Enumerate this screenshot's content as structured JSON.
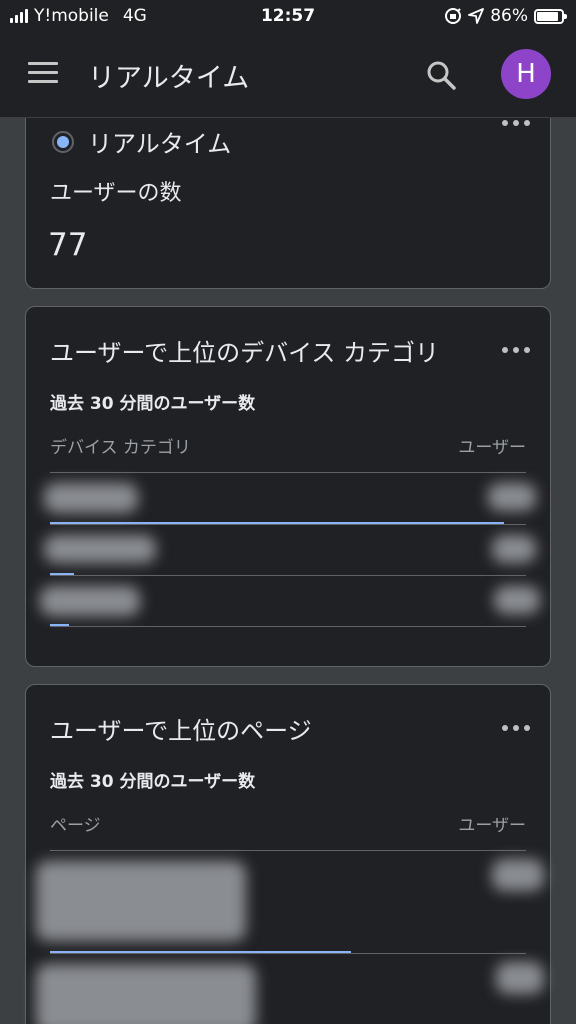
{
  "status_bar": {
    "carrier": "Y!mobile",
    "network": "4G",
    "time": "12:57",
    "battery": "86%",
    "battery_level": 0.86
  },
  "header": {
    "title": "リアルタイム",
    "avatar_letter": "H"
  },
  "realtime_card": {
    "radio_label": "リアルタイム",
    "metric_label": "ユーザーの数",
    "metric_value": "77"
  },
  "device_card": {
    "title": "ユーザーで上位のデバイス カテゴリ",
    "subtitle": "過去 30 分間のユーザー数",
    "col_left": "デバイス カテゴリ",
    "col_right": "ユーザー",
    "rows": [
      {
        "bar_fraction": 0.95
      },
      {
        "bar_fraction": 0.05
      },
      {
        "bar_fraction": 0.04
      }
    ]
  },
  "page_card": {
    "title": "ユーザーで上位のページ",
    "subtitle": "過去 30 分間のユーザー数",
    "col_left": "ページ",
    "col_right": "ユーザー",
    "rows": [
      {
        "bar_fraction": 0.63
      },
      {
        "bar_fraction": 0.0
      }
    ]
  },
  "colors": {
    "accent": "#8ab4f8",
    "avatar": "#8e44c9",
    "card_bg": "#202124",
    "page_bg": "#3c4043"
  },
  "icons": [
    "signal-icon",
    "location-lock-icon",
    "location-arrow-icon",
    "battery-icon",
    "menu-icon",
    "search-icon",
    "more-icon"
  ]
}
